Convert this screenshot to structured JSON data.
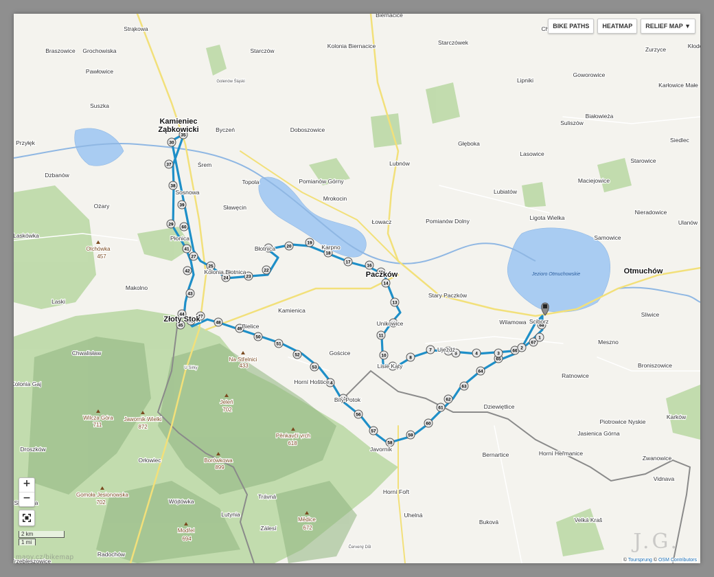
{
  "controls": {
    "bike_paths": "BIKE PATHS",
    "heatmap": "HEATMAP",
    "relief_map": "RELIEF MAP ▼",
    "zoom_in": "+",
    "zoom_out": "−"
  },
  "scale": {
    "km": "2 km",
    "mi": "1 mi"
  },
  "attribution": {
    "prefix": "© ",
    "tourenplaner": "Toursprung",
    "mid": " © ",
    "osm": "OSM Contributors"
  },
  "watermark": {
    "left": "mapy.cz/bikemap",
    "right": "J.G."
  },
  "colors": {
    "route": "#1e8fc8",
    "water": "#a9ccf2",
    "forest": "#b8d7a4",
    "border": "#8a8a8a",
    "road_major": "#f2e07a"
  },
  "lake_labels": {
    "otmuchow_lake": "Jezioro Otmuchowskie"
  },
  "places": [
    {
      "name": "Strąkowa",
      "cls": "small"
    },
    {
      "name": "Braszowice",
      "cls": "small"
    },
    {
      "name": "Grochowiska",
      "cls": "small"
    },
    {
      "name": "Pawłowice",
      "cls": "small"
    },
    {
      "name": "Suszka",
      "cls": "small"
    },
    {
      "name": "Kamieniec",
      "cls": "town"
    },
    {
      "name": "Ząbkowicki",
      "cls": "town"
    },
    {
      "name": "Przyłęk",
      "cls": "small"
    },
    {
      "name": "Byczeń",
      "cls": "small"
    },
    {
      "name": "Starczów",
      "cls": "small"
    },
    {
      "name": "Golenów Śląski",
      "cls": "tiny"
    },
    {
      "name": "Kolonia Biernacice",
      "cls": "small"
    },
    {
      "name": "Biernacice",
      "cls": "small"
    },
    {
      "name": "Starczówek",
      "cls": "small"
    },
    {
      "name": "Chociebórz",
      "cls": "small"
    },
    {
      "name": "Zurzyce",
      "cls": "small"
    },
    {
      "name": "Kłodob",
      "cls": "small"
    },
    {
      "name": "Goworowice",
      "cls": "small"
    },
    {
      "name": "Lipniki",
      "cls": "small"
    },
    {
      "name": "Karłowice Małe",
      "cls": "small"
    },
    {
      "name": "Doboszowice",
      "cls": "small"
    },
    {
      "name": "Białowieża",
      "cls": "small"
    },
    {
      "name": "Suliszów",
      "cls": "small"
    },
    {
      "name": "Głęboka",
      "cls": "small"
    },
    {
      "name": "Siedlec",
      "cls": "small"
    },
    {
      "name": "Lubnów",
      "cls": "small"
    },
    {
      "name": "Śrem",
      "cls": "small"
    },
    {
      "name": "Dzbanów",
      "cls": "small"
    },
    {
      "name": "Lasowice",
      "cls": "small"
    },
    {
      "name": "Starowice",
      "cls": "small"
    },
    {
      "name": "Pomianów Górny",
      "cls": "small"
    },
    {
      "name": "Topola",
      "cls": "small"
    },
    {
      "name": "Maciejowice",
      "cls": "small"
    },
    {
      "name": "Mrokocin",
      "cls": "small"
    },
    {
      "name": "Sosnowa",
      "cls": "small"
    },
    {
      "name": "Ożary",
      "cls": "small"
    },
    {
      "name": "Sławęcin",
      "cls": "small"
    },
    {
      "name": "Lubiatów",
      "cls": "small"
    },
    {
      "name": "Łowacz",
      "cls": "small"
    },
    {
      "name": "Nieradowice",
      "cls": "small"
    },
    {
      "name": "Pomianów Dolny",
      "cls": "small"
    },
    {
      "name": "Ligota Wielka",
      "cls": "small"
    },
    {
      "name": "Ulanów",
      "cls": "small"
    },
    {
      "name": "Laskówka",
      "cls": "small"
    },
    {
      "name": "Olchówka",
      "cls": "peak"
    },
    {
      "name": "457",
      "cls": "peakh"
    },
    {
      "name": "Płonica",
      "cls": "small"
    },
    {
      "name": "Samowice",
      "cls": "small"
    },
    {
      "name": "Błotnica",
      "cls": "small"
    },
    {
      "name": "Kolonia Błotnica",
      "cls": "small"
    },
    {
      "name": "Karpno",
      "cls": "small"
    },
    {
      "name": "Paczków",
      "cls": "town"
    },
    {
      "name": "Otmuchów",
      "cls": "town"
    },
    {
      "name": "Makolno",
      "cls": "small"
    },
    {
      "name": "Laski",
      "cls": "small"
    },
    {
      "name": "Stary Paczków",
      "cls": "small"
    },
    {
      "name": "Złoty Stok",
      "cls": "town"
    },
    {
      "name": "Kamienica",
      "cls": "small"
    },
    {
      "name": "Unikowice",
      "cls": "small"
    },
    {
      "name": "Wilamowa",
      "cls": "small"
    },
    {
      "name": "Sciborz",
      "cls": "small"
    },
    {
      "name": "Sliwice",
      "cls": "small"
    },
    {
      "name": "Bielice",
      "cls": "small"
    },
    {
      "name": "Meszno",
      "cls": "small"
    },
    {
      "name": "Chwalisław",
      "cls": "small"
    },
    {
      "name": "Na Střelnici",
      "cls": "peak"
    },
    {
      "name": "433",
      "cls": "peakh"
    },
    {
      "name": "Gościce",
      "cls": "small"
    },
    {
      "name": "Lisie Kąty",
      "cls": "small"
    },
    {
      "name": "Ujeźdź",
      "cls": "small"
    },
    {
      "name": "U Sirky",
      "cls": "tiny"
    },
    {
      "name": "Horní Hoštice",
      "cls": "small"
    },
    {
      "name": "Broniszowice",
      "cls": "small"
    },
    {
      "name": "Kolonia Gaj",
      "cls": "small"
    },
    {
      "name": "Ratnowice",
      "cls": "small"
    },
    {
      "name": "Dziewiętlice",
      "cls": "small"
    },
    {
      "name": "Jeleń",
      "cls": "peak"
    },
    {
      "name": "702",
      "cls": "peakh"
    },
    {
      "name": "Bílý Potok",
      "cls": "small"
    },
    {
      "name": "Piotrowice Nyskie",
      "cls": "small"
    },
    {
      "name": "Wilcza Góra",
      "cls": "peak"
    },
    {
      "name": "711",
      "cls": "peakh"
    },
    {
      "name": "Jawornik Wielki",
      "cls": "peak"
    },
    {
      "name": "872",
      "cls": "peakh"
    },
    {
      "name": "Karków",
      "cls": "small"
    },
    {
      "name": "Pěnkavčí vrch",
      "cls": "peak"
    },
    {
      "name": "618",
      "cls": "peakh"
    },
    {
      "name": "Jasienica Górna",
      "cls": "small"
    },
    {
      "name": "Droszków",
      "cls": "small"
    },
    {
      "name": "Orłowiec",
      "cls": "small"
    },
    {
      "name": "Javorník",
      "cls": "small"
    },
    {
      "name": "Bernartice",
      "cls": "small"
    },
    {
      "name": "Horní Heřmanice",
      "cls": "small"
    },
    {
      "name": "Zwanowice",
      "cls": "small"
    },
    {
      "name": "Borówkowa",
      "cls": "peak"
    },
    {
      "name": "899",
      "cls": "peakh"
    },
    {
      "name": "Gomoła Jesionowska",
      "cls": "peak"
    },
    {
      "name": "702",
      "cls": "peakh"
    },
    {
      "name": "Wójtówka",
      "cls": "small"
    },
    {
      "name": "Horní Fořt",
      "cls": "small"
    },
    {
      "name": "Trávná",
      "cls": "small"
    },
    {
      "name": "Vidnava",
      "cls": "small"
    },
    {
      "name": "Skrzynka",
      "cls": "small"
    },
    {
      "name": "Lutynia",
      "cls": "small"
    },
    {
      "name": "Uhelná",
      "cls": "small"
    },
    {
      "name": "Buková",
      "cls": "small"
    },
    {
      "name": "Mědice",
      "cls": "peak"
    },
    {
      "name": "672",
      "cls": "peakh"
    },
    {
      "name": "Velká Kraš",
      "cls": "small"
    },
    {
      "name": "Modřel",
      "cls": "peak"
    },
    {
      "name": "694",
      "cls": "peakh"
    },
    {
      "name": "Zálesí",
      "cls": "small"
    },
    {
      "name": "Radochów",
      "cls": "small"
    },
    {
      "name": "Červený Důl",
      "cls": "tiny"
    },
    {
      "name": "Trzebieszowice",
      "cls": "small"
    }
  ],
  "route": {
    "start_label": "start",
    "nodes": [
      "30",
      "35",
      "37",
      "38",
      "39",
      "29",
      "60",
      "26",
      "41",
      "27",
      "42",
      "43",
      "44",
      "45",
      "46",
      "47",
      "48",
      "49",
      "50",
      "51",
      "52",
      "53",
      "54",
      "55",
      "56",
      "57",
      "58",
      "59",
      "60",
      "61",
      "62",
      "63",
      "64",
      "65",
      "66",
      "2",
      "67",
      "1",
      "68",
      "3",
      "4",
      "5",
      "6",
      "7",
      "8",
      "9",
      "10",
      "11",
      "12",
      "13",
      "14",
      "15",
      "16",
      "17",
      "18",
      "19",
      "20",
      "21",
      "22",
      "23",
      "24",
      "25",
      "26"
    ]
  }
}
